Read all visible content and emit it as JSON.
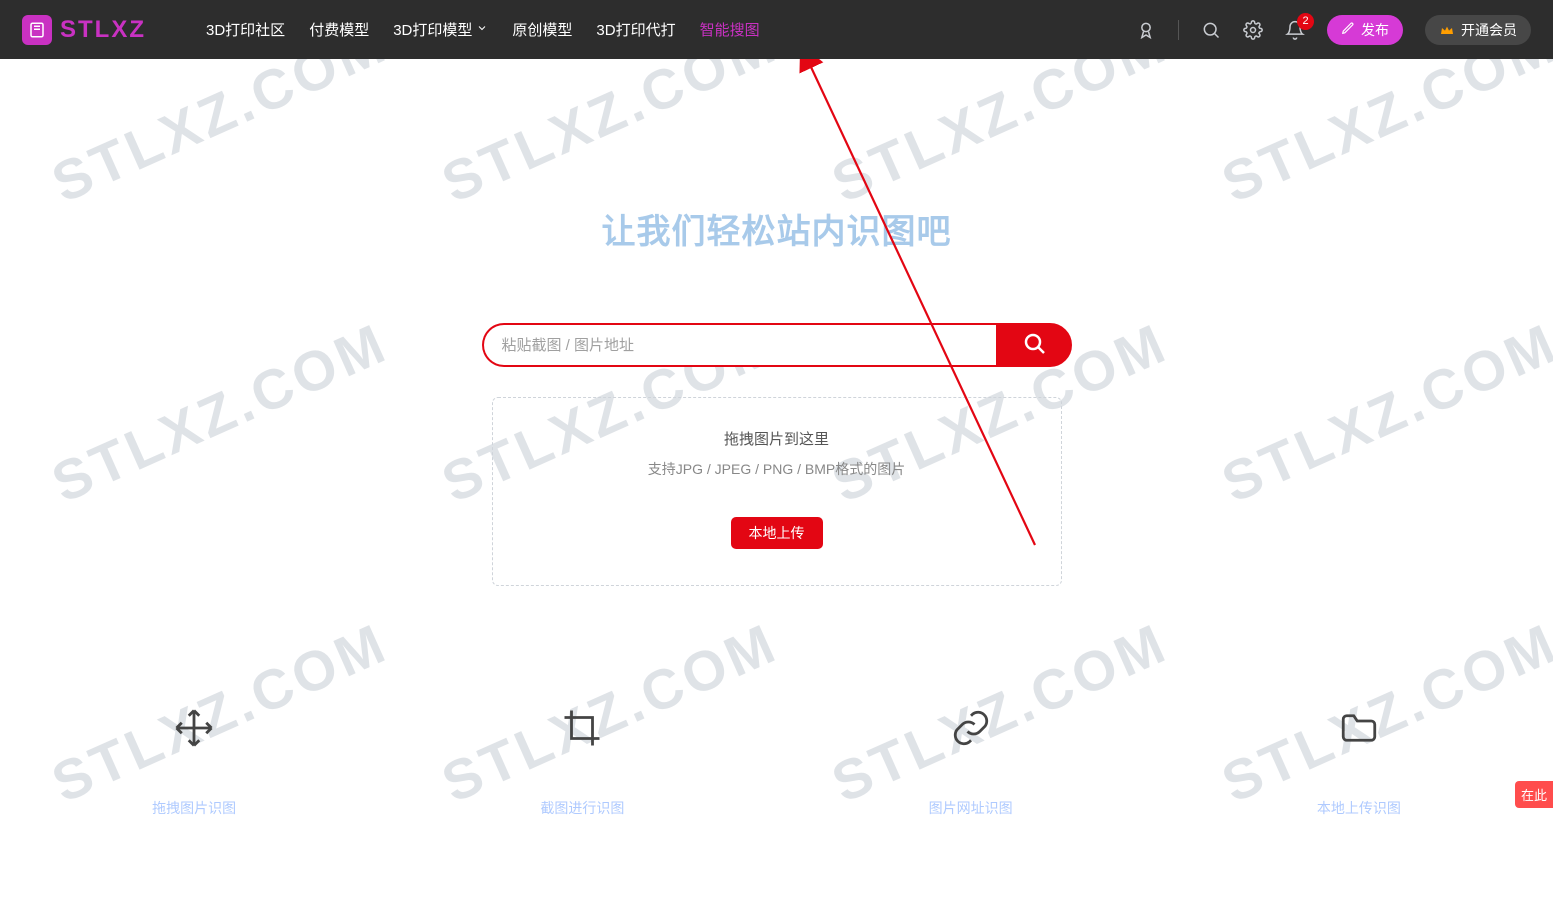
{
  "brand": "STLXZ",
  "watermark_text": "STLXZ.COM",
  "nav": {
    "items": [
      {
        "label": "3D打印社区",
        "active": false,
        "has_submenu": false
      },
      {
        "label": "付费模型",
        "active": false,
        "has_submenu": false
      },
      {
        "label": "3D打印模型",
        "active": false,
        "has_submenu": true
      },
      {
        "label": "原创模型",
        "active": false,
        "has_submenu": false
      },
      {
        "label": "3D打印代打",
        "active": false,
        "has_submenu": false
      },
      {
        "label": "智能搜图",
        "active": true,
        "has_submenu": false
      }
    ],
    "notification_count": "2",
    "publish_label": "发布",
    "vip_label": "开通会员"
  },
  "hero": {
    "heading": "让我们轻松站内识图吧",
    "search_placeholder": "粘贴截图 / 图片地址",
    "search_value": "",
    "drop_title": "拖拽图片到这里",
    "drop_sub": "支持JPG / JPEG / PNG / BMP格式的图片",
    "upload_label": "本地上传"
  },
  "features": [
    {
      "label": "拖拽图片识图"
    },
    {
      "label": "截图进行识图"
    },
    {
      "label": "图片网址识图"
    },
    {
      "label": "本地上传识图"
    }
  ],
  "corner_tag": "在此"
}
